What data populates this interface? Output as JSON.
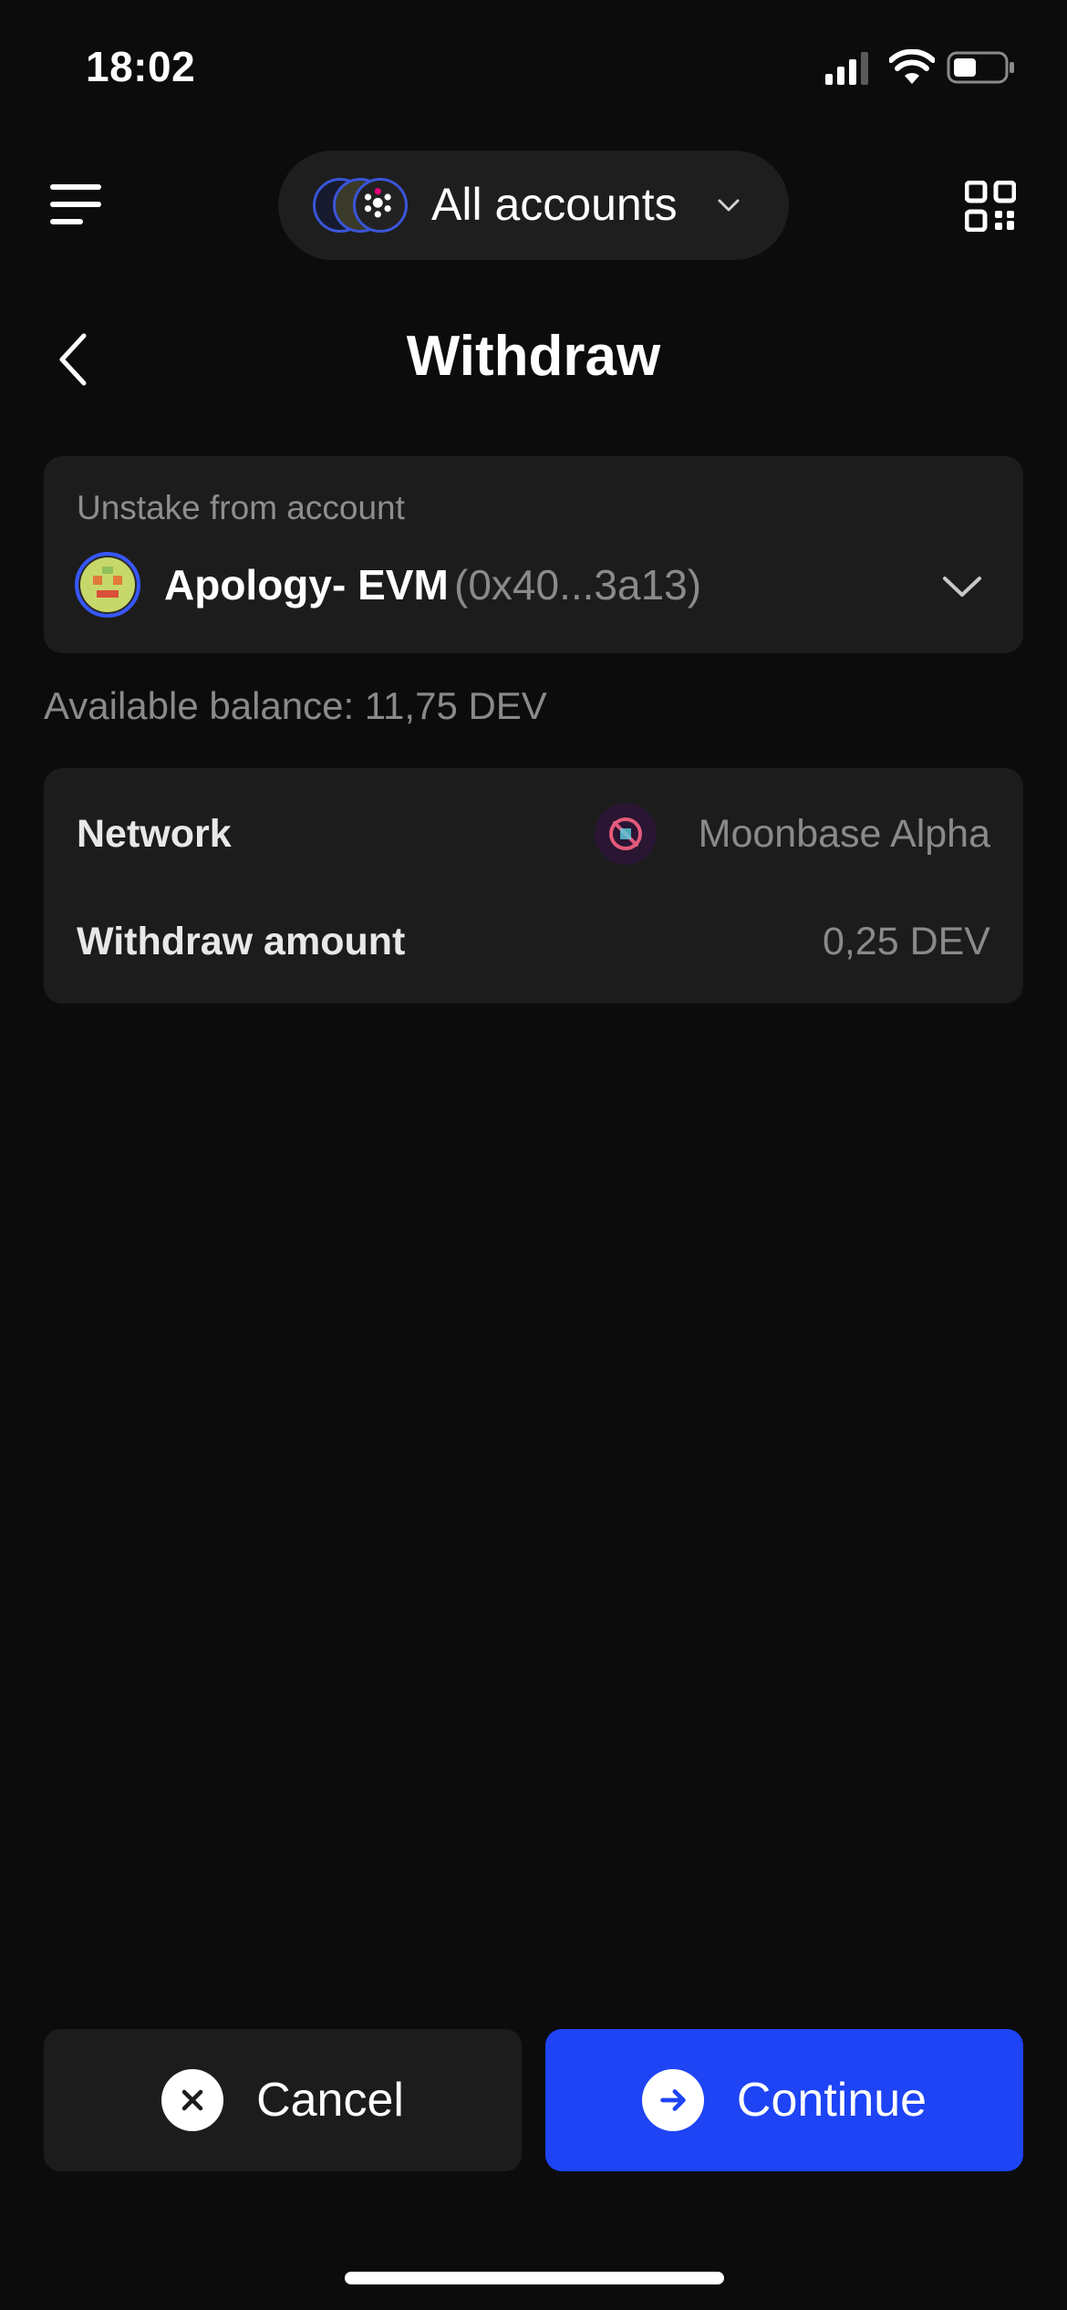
{
  "status_bar": {
    "time": "18:02"
  },
  "header": {
    "accounts_label": "All accounts"
  },
  "page": {
    "title": "Withdraw"
  },
  "account_selector": {
    "label": "Unstake from account",
    "account_name": "Apology- EVM",
    "account_address": "(0x40...3a13)"
  },
  "balance": {
    "text": "Available balance: 11,75 DEV"
  },
  "details": {
    "network_label": "Network",
    "network_value": "Moonbase Alpha",
    "amount_label": "Withdraw amount",
    "amount_value": "0,25 DEV"
  },
  "actions": {
    "cancel_label": "Cancel",
    "continue_label": "Continue"
  },
  "colors": {
    "background": "#0c0c0c",
    "card": "#1c1c1c",
    "accent": "#1e44f5"
  }
}
